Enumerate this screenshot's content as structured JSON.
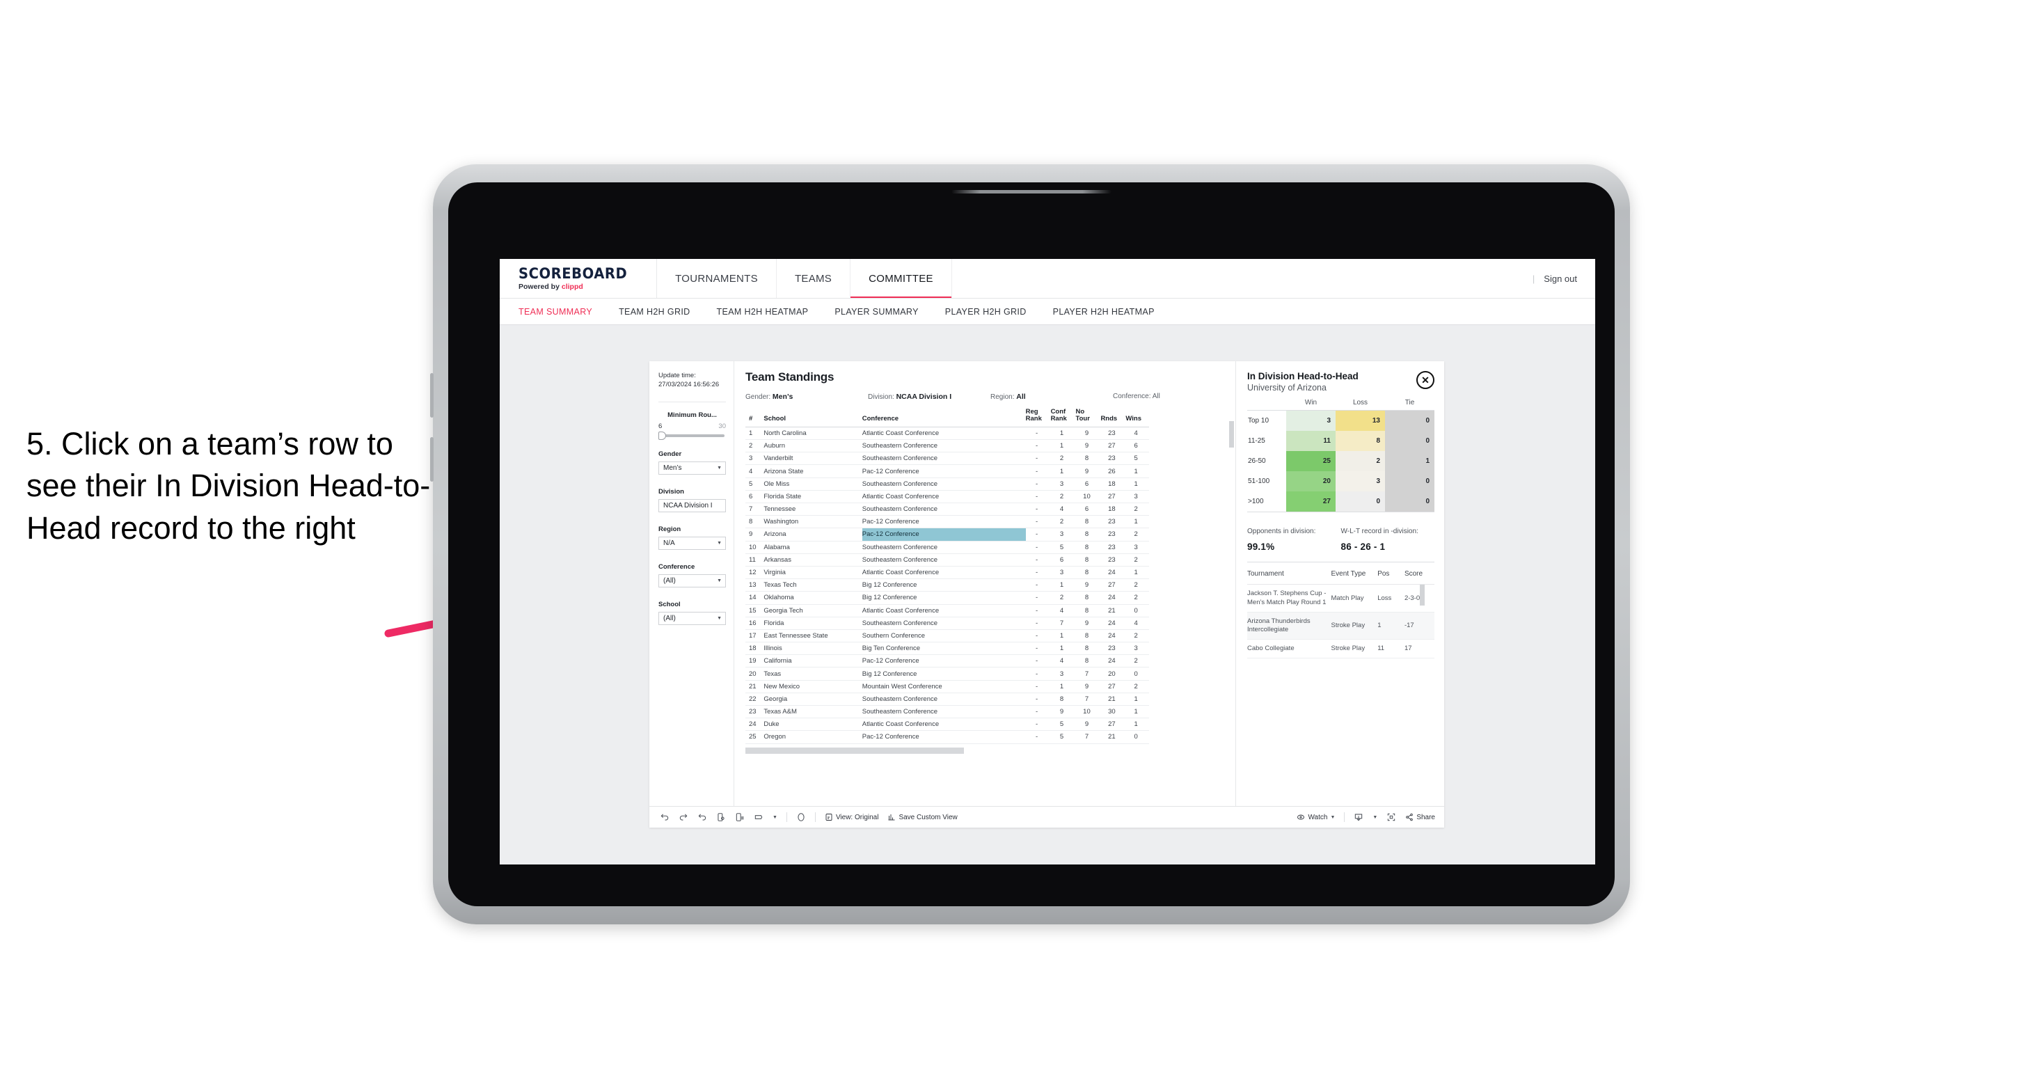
{
  "annotation": {
    "text": "5. Click on a team’s row to see their In Division Head-to-Head record to the right",
    "arrow_color": "#ee2a64"
  },
  "brand": {
    "title": "SCOREBOARD",
    "powered_prefix": "Powered by ",
    "powered_name": "clippd"
  },
  "topnav": {
    "items": [
      {
        "label": "TOURNAMENTS",
        "active": false
      },
      {
        "label": "TEAMS",
        "active": false
      },
      {
        "label": "COMMITTEE",
        "active": true
      }
    ],
    "separator": "|",
    "signout": "Sign out"
  },
  "subtabs": [
    {
      "label": "TEAM SUMMARY",
      "active": true
    },
    {
      "label": "TEAM H2H GRID",
      "active": false
    },
    {
      "label": "TEAM H2H HEATMAP",
      "active": false
    },
    {
      "label": "PLAYER SUMMARY",
      "active": false
    },
    {
      "label": "PLAYER H2H GRID",
      "active": false
    },
    {
      "label": "PLAYER H2H HEATMAP",
      "active": false
    }
  ],
  "rail": {
    "update_label": "Update time:",
    "update_time": "27/03/2024 16:56:26",
    "slider": {
      "title": "Minimum Rou...",
      "min": "6",
      "max": "30"
    },
    "filters": [
      {
        "title": "Gender",
        "value": "Men’s"
      },
      {
        "title": "Division",
        "value": "NCAA Division I"
      },
      {
        "title": "Region",
        "value": "N/A"
      },
      {
        "title": "Conference",
        "value": "(All)"
      },
      {
        "title": "School",
        "value": "(All)"
      }
    ]
  },
  "viz": {
    "title": "Team Standings",
    "filters": [
      {
        "label": "Gender:",
        "value": "Men’s"
      },
      {
        "label": "Division:",
        "value": "NCAA Division I"
      },
      {
        "label": "Region:",
        "value": "All"
      },
      {
        "label": "Conference:",
        "value": "All"
      }
    ],
    "columns": [
      "#",
      "School",
      "Conference",
      "Reg Rank",
      "Conf Rank",
      "No Tour",
      "Rnds",
      "Wins"
    ],
    "rows": [
      {
        "n": "1",
        "school": "North Carolina",
        "conf": "Atlantic Coast Conference",
        "reg": "-",
        "confrank": "1",
        "notour": "9",
        "rnds": "23",
        "wins": "4"
      },
      {
        "n": "2",
        "school": "Auburn",
        "conf": "Southeastern Conference",
        "reg": "-",
        "confrank": "1",
        "notour": "9",
        "rnds": "27",
        "wins": "6"
      },
      {
        "n": "3",
        "school": "Vanderbilt",
        "conf": "Southeastern Conference",
        "reg": "-",
        "confrank": "2",
        "notour": "8",
        "rnds": "23",
        "wins": "5"
      },
      {
        "n": "4",
        "school": "Arizona State",
        "conf": "Pac-12 Conference",
        "reg": "-",
        "confrank": "1",
        "notour": "9",
        "rnds": "26",
        "wins": "1"
      },
      {
        "n": "5",
        "school": "Ole Miss",
        "conf": "Southeastern Conference",
        "reg": "-",
        "confrank": "3",
        "notour": "6",
        "rnds": "18",
        "wins": "1"
      },
      {
        "n": "6",
        "school": "Florida State",
        "conf": "Atlantic Coast Conference",
        "reg": "-",
        "confrank": "2",
        "notour": "10",
        "rnds": "27",
        "wins": "3"
      },
      {
        "n": "7",
        "school": "Tennessee",
        "conf": "Southeastern Conference",
        "reg": "-",
        "confrank": "4",
        "notour": "6",
        "rnds": "18",
        "wins": "2"
      },
      {
        "n": "8",
        "school": "Washington",
        "conf": "Pac-12 Conference",
        "reg": "-",
        "confrank": "2",
        "notour": "8",
        "rnds": "23",
        "wins": "1"
      },
      {
        "n": "9",
        "school": "Arizona",
        "conf": "Pac-12 Conference",
        "reg": "-",
        "confrank": "3",
        "notour": "8",
        "rnds": "23",
        "wins": "2",
        "selected": true
      },
      {
        "n": "10",
        "school": "Alabama",
        "conf": "Southeastern Conference",
        "reg": "-",
        "confrank": "5",
        "notour": "8",
        "rnds": "23",
        "wins": "3"
      },
      {
        "n": "11",
        "school": "Arkansas",
        "conf": "Southeastern Conference",
        "reg": "-",
        "confrank": "6",
        "notour": "8",
        "rnds": "23",
        "wins": "2"
      },
      {
        "n": "12",
        "school": "Virginia",
        "conf": "Atlantic Coast Conference",
        "reg": "-",
        "confrank": "3",
        "notour": "8",
        "rnds": "24",
        "wins": "1"
      },
      {
        "n": "13",
        "school": "Texas Tech",
        "conf": "Big 12 Conference",
        "reg": "-",
        "confrank": "1",
        "notour": "9",
        "rnds": "27",
        "wins": "2"
      },
      {
        "n": "14",
        "school": "Oklahoma",
        "conf": "Big 12 Conference",
        "reg": "-",
        "confrank": "2",
        "notour": "8",
        "rnds": "24",
        "wins": "2"
      },
      {
        "n": "15",
        "school": "Georgia Tech",
        "conf": "Atlantic Coast Conference",
        "reg": "-",
        "confrank": "4",
        "notour": "8",
        "rnds": "21",
        "wins": "0"
      },
      {
        "n": "16",
        "school": "Florida",
        "conf": "Southeastern Conference",
        "reg": "-",
        "confrank": "7",
        "notour": "9",
        "rnds": "24",
        "wins": "4"
      },
      {
        "n": "17",
        "school": "East Tennessee State",
        "conf": "Southern Conference",
        "reg": "-",
        "confrank": "1",
        "notour": "8",
        "rnds": "24",
        "wins": "2"
      },
      {
        "n": "18",
        "school": "Illinois",
        "conf": "Big Ten Conference",
        "reg": "-",
        "confrank": "1",
        "notour": "8",
        "rnds": "23",
        "wins": "3"
      },
      {
        "n": "19",
        "school": "California",
        "conf": "Pac-12 Conference",
        "reg": "-",
        "confrank": "4",
        "notour": "8",
        "rnds": "24",
        "wins": "2"
      },
      {
        "n": "20",
        "school": "Texas",
        "conf": "Big 12 Conference",
        "reg": "-",
        "confrank": "3",
        "notour": "7",
        "rnds": "20",
        "wins": "0"
      },
      {
        "n": "21",
        "school": "New Mexico",
        "conf": "Mountain West Conference",
        "reg": "-",
        "confrank": "1",
        "notour": "9",
        "rnds": "27",
        "wins": "2"
      },
      {
        "n": "22",
        "school": "Georgia",
        "conf": "Southeastern Conference",
        "reg": "-",
        "confrank": "8",
        "notour": "7",
        "rnds": "21",
        "wins": "1"
      },
      {
        "n": "23",
        "school": "Texas A&M",
        "conf": "Southeastern Conference",
        "reg": "-",
        "confrank": "9",
        "notour": "10",
        "rnds": "30",
        "wins": "1"
      },
      {
        "n": "24",
        "school": "Duke",
        "conf": "Atlantic Coast Conference",
        "reg": "-",
        "confrank": "5",
        "notour": "9",
        "rnds": "27",
        "wins": "1"
      },
      {
        "n": "25",
        "school": "Oregon",
        "conf": "Pac-12 Conference",
        "reg": "-",
        "confrank": "5",
        "notour": "7",
        "rnds": "21",
        "wins": "0"
      }
    ],
    "selected_highlight_color": "#8fc6d4"
  },
  "detail": {
    "title": "In Division Head-to-Head",
    "subtitle": "University of Arizona",
    "close_icon": "✕",
    "h2h": {
      "columns": [
        "Win",
        "Loss",
        "Tie"
      ],
      "rows": [
        {
          "bucket": "Top 10",
          "win": "3",
          "loss": "13",
          "tie": "0",
          "win_color": "#e3efe3",
          "loss_color": "#f2e08a",
          "tie_color": "#d2d2d2"
        },
        {
          "bucket": "11-25",
          "win": "11",
          "loss": "8",
          "tie": "0",
          "win_color": "#cbe5bf",
          "loss_color": "#f5ecc6",
          "tie_color": "#d2d2d2"
        },
        {
          "bucket": "26-50",
          "win": "25",
          "loss": "2",
          "tie": "1",
          "win_color": "#7cc96a",
          "loss_color": "#f1efe8",
          "tie_color": "#d2d2d2"
        },
        {
          "bucket": "51-100",
          "win": "20",
          "loss": "3",
          "tie": "0",
          "win_color": "#96d486",
          "loss_color": "#f3f1ea",
          "tie_color": "#d2d2d2"
        },
        {
          "bucket": ">100",
          "win": "27",
          "loss": "0",
          "tie": "0",
          "win_color": "#85cf72",
          "loss_color": "#eeeeee",
          "tie_color": "#d2d2d2"
        }
      ]
    },
    "stats": [
      {
        "label": "Opponents in division:",
        "value": "99.1%"
      },
      {
        "label": "W-L-T record in -division:",
        "value": "86 - 26 - 1"
      }
    ],
    "tournaments": {
      "columns": [
        "Tournament",
        "Event Type",
        "Pos",
        "Score"
      ],
      "rows": [
        {
          "name": "Jackson T. Stephens Cup - Men’s Match Play Round 1",
          "type": "Match Play",
          "pos": "Loss",
          "score": "2-3-0"
        },
        {
          "name": "Arizona Thunderbirds Intercollegiate",
          "type": "Stroke Play",
          "pos": "1",
          "score": "-17"
        },
        {
          "name": "Cabo Collegiate",
          "type": "Stroke Play",
          "pos": "11",
          "score": "17"
        }
      ]
    }
  },
  "toolbar": {
    "view_label": "View: Original",
    "save_label": "Save Custom View",
    "watch_label": "Watch",
    "share_label": "Share"
  }
}
